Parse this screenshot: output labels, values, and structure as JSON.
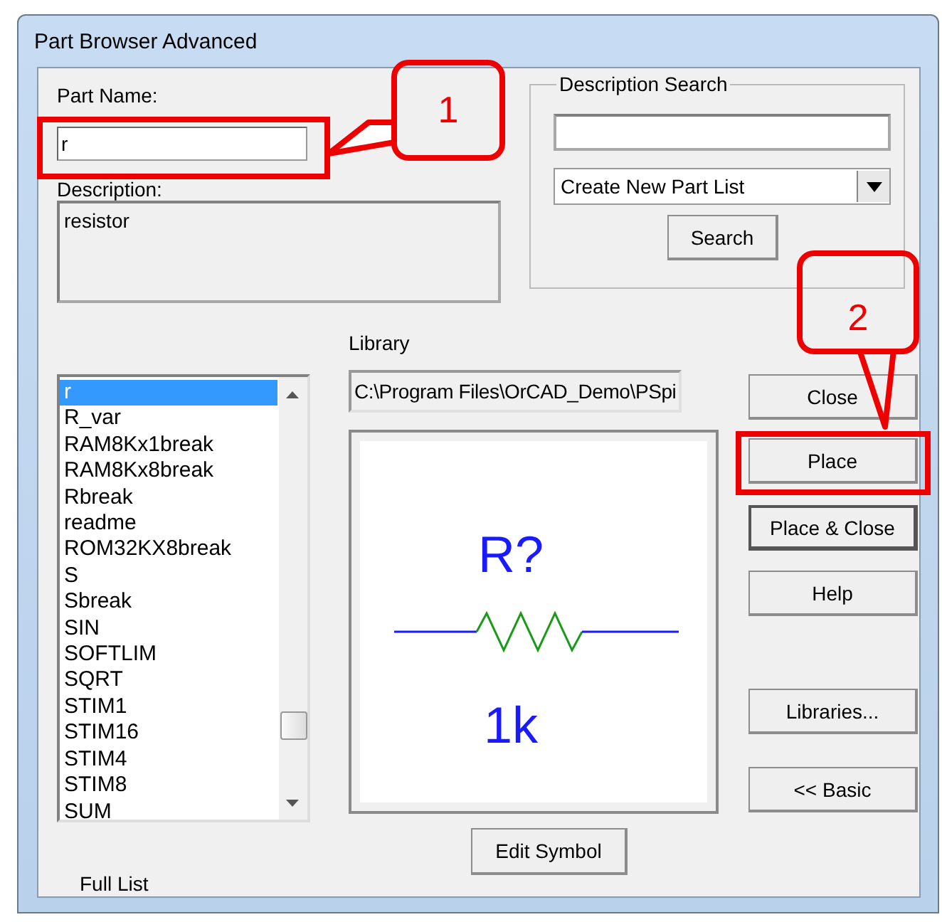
{
  "window": {
    "title": "Part Browser Advanced"
  },
  "part_name": {
    "label": "Part Name:",
    "value": "r",
    "highlighted": true
  },
  "description": {
    "label": "Description:",
    "value": "resistor"
  },
  "description_search": {
    "title": "Description Search",
    "dropdown": "Create New Part List",
    "button": "Search"
  },
  "library": {
    "label": "Library",
    "path": "C:\\Program Files\\OrCAD_Demo\\PSpi"
  },
  "parts": [
    {
      "name": "r",
      "selected": true
    },
    {
      "name": "R_var",
      "selected": false
    },
    {
      "name": "RAM8Kx1break",
      "selected": false
    },
    {
      "name": "RAM8Kx8break",
      "selected": false
    },
    {
      "name": "Rbreak",
      "selected": false
    },
    {
      "name": "readme",
      "selected": false
    },
    {
      "name": "ROM32KX8break",
      "selected": false
    },
    {
      "name": "S",
      "selected": false
    },
    {
      "name": "Sbreak",
      "selected": false
    },
    {
      "name": "SIN",
      "selected": false
    },
    {
      "name": "SOFTLIM",
      "selected": false
    },
    {
      "name": "SQRT",
      "selected": false
    },
    {
      "name": "STIM1",
      "selected": false
    },
    {
      "name": "STIM16",
      "selected": false
    },
    {
      "name": "STIM4",
      "selected": false
    },
    {
      "name": "STIM8",
      "selected": false
    },
    {
      "name": "SUM",
      "selected": false
    }
  ],
  "full_list_label": "Full List",
  "preview": {
    "reference": "R?",
    "value": "1k"
  },
  "edit_symbol": "Edit Symbol",
  "buttons": [
    {
      "label": "Close",
      "highlighted": false,
      "default": false
    },
    {
      "label": "Place",
      "highlighted": true,
      "default": false
    },
    {
      "label": "Place & Close",
      "highlighted": false,
      "default": true
    },
    {
      "label": "Help",
      "highlighted": false,
      "default": false
    },
    {
      "label": "Libraries...",
      "highlighted": false,
      "default": false
    },
    {
      "label": "<< Basic",
      "highlighted": false,
      "default": false
    }
  ],
  "callouts": [
    {
      "label": "1"
    },
    {
      "label": "2"
    }
  ]
}
